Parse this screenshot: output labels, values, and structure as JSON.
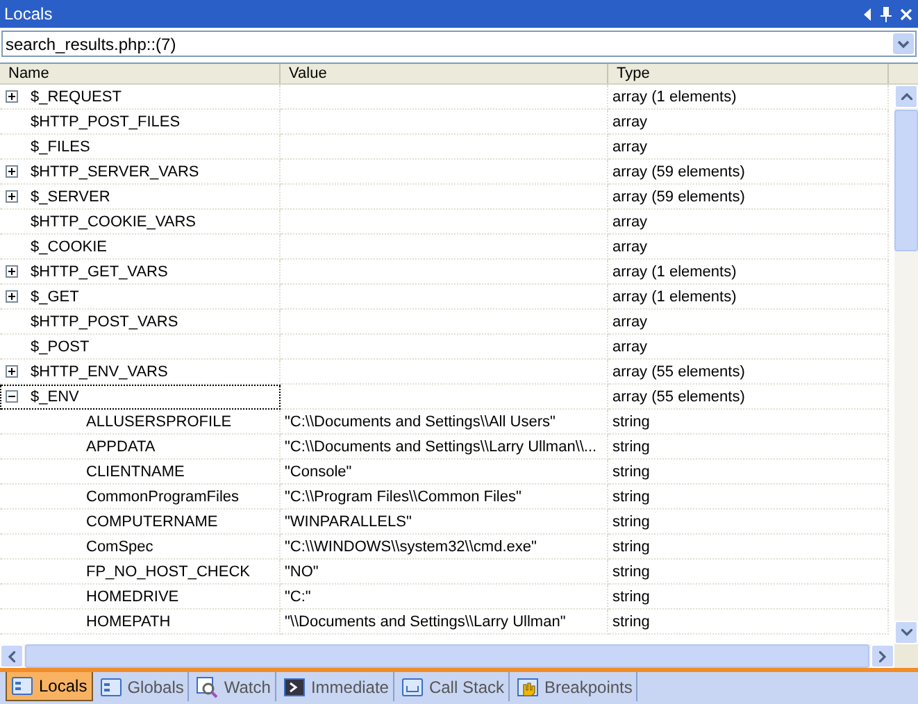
{
  "window": {
    "title": "Locals"
  },
  "context": {
    "value": "search_results.php::(7)"
  },
  "table": {
    "columns": [
      "Name",
      "Value",
      "Type"
    ],
    "rows": [
      {
        "kind": "group",
        "expanded": false,
        "name": "$_REQUEST",
        "value": "",
        "type": "array (1 elements)"
      },
      {
        "kind": "leaf",
        "name": "$HTTP_POST_FILES",
        "value": "",
        "type": "array"
      },
      {
        "kind": "leaf",
        "name": "$_FILES",
        "value": "",
        "type": "array"
      },
      {
        "kind": "group",
        "expanded": false,
        "name": "$HTTP_SERVER_VARS",
        "value": "",
        "type": "array (59 elements)"
      },
      {
        "kind": "group",
        "expanded": false,
        "name": "$_SERVER",
        "value": "",
        "type": "array (59 elements)"
      },
      {
        "kind": "leaf",
        "name": "$HTTP_COOKIE_VARS",
        "value": "",
        "type": "array"
      },
      {
        "kind": "leaf",
        "name": "$_COOKIE",
        "value": "",
        "type": "array"
      },
      {
        "kind": "group",
        "expanded": false,
        "name": "$HTTP_GET_VARS",
        "value": "",
        "type": "array (1 elements)"
      },
      {
        "kind": "group",
        "expanded": false,
        "name": "$_GET",
        "value": "",
        "type": "array (1 elements)"
      },
      {
        "kind": "leaf",
        "name": "$HTTP_POST_VARS",
        "value": "",
        "type": "array"
      },
      {
        "kind": "leaf",
        "name": "$_POST",
        "value": "",
        "type": "array"
      },
      {
        "kind": "group",
        "expanded": false,
        "name": "$HTTP_ENV_VARS",
        "value": "",
        "type": "array (55 elements)"
      },
      {
        "kind": "group",
        "expanded": true,
        "selected": true,
        "name": "$_ENV",
        "value": "",
        "type": "array (55 elements)",
        "children": [
          {
            "kind": "leaf",
            "name": "ALLUSERSPROFILE",
            "value": "\"C:\\\\Documents and Settings\\\\All Users\"",
            "type": "string"
          },
          {
            "kind": "leaf",
            "name": "APPDATA",
            "value": "\"C:\\\\Documents and Settings\\\\Larry Ullman\\\\...",
            "type": "string"
          },
          {
            "kind": "leaf",
            "name": "CLIENTNAME",
            "value": "\"Console\"",
            "type": "string"
          },
          {
            "kind": "leaf",
            "name": "CommonProgramFiles",
            "value": "\"C:\\\\Program Files\\\\Common Files\"",
            "type": "string"
          },
          {
            "kind": "leaf",
            "name": "COMPUTERNAME",
            "value": "\"WINPARALLELS\"",
            "type": "string"
          },
          {
            "kind": "leaf",
            "name": "ComSpec",
            "value": "\"C:\\\\WINDOWS\\\\system32\\\\cmd.exe\"",
            "type": "string"
          },
          {
            "kind": "leaf",
            "name": "FP_NO_HOST_CHECK",
            "value": "\"NO\"",
            "type": "string"
          },
          {
            "kind": "leaf",
            "name": "HOMEDRIVE",
            "value": "\"C:\"",
            "type": "string"
          },
          {
            "kind": "leaf",
            "name": "HOMEPATH",
            "value": "\"\\\\Documents and Settings\\\\Larry Ullman\"",
            "type": "string"
          }
        ]
      }
    ]
  },
  "tabs": [
    {
      "label": "Locals",
      "selected": true
    },
    {
      "label": "Globals",
      "selected": false
    },
    {
      "label": "Watch",
      "selected": false
    },
    {
      "label": "Immediate",
      "selected": false
    },
    {
      "label": "Call Stack",
      "selected": false
    },
    {
      "label": "Breakpoints",
      "selected": false
    }
  ]
}
